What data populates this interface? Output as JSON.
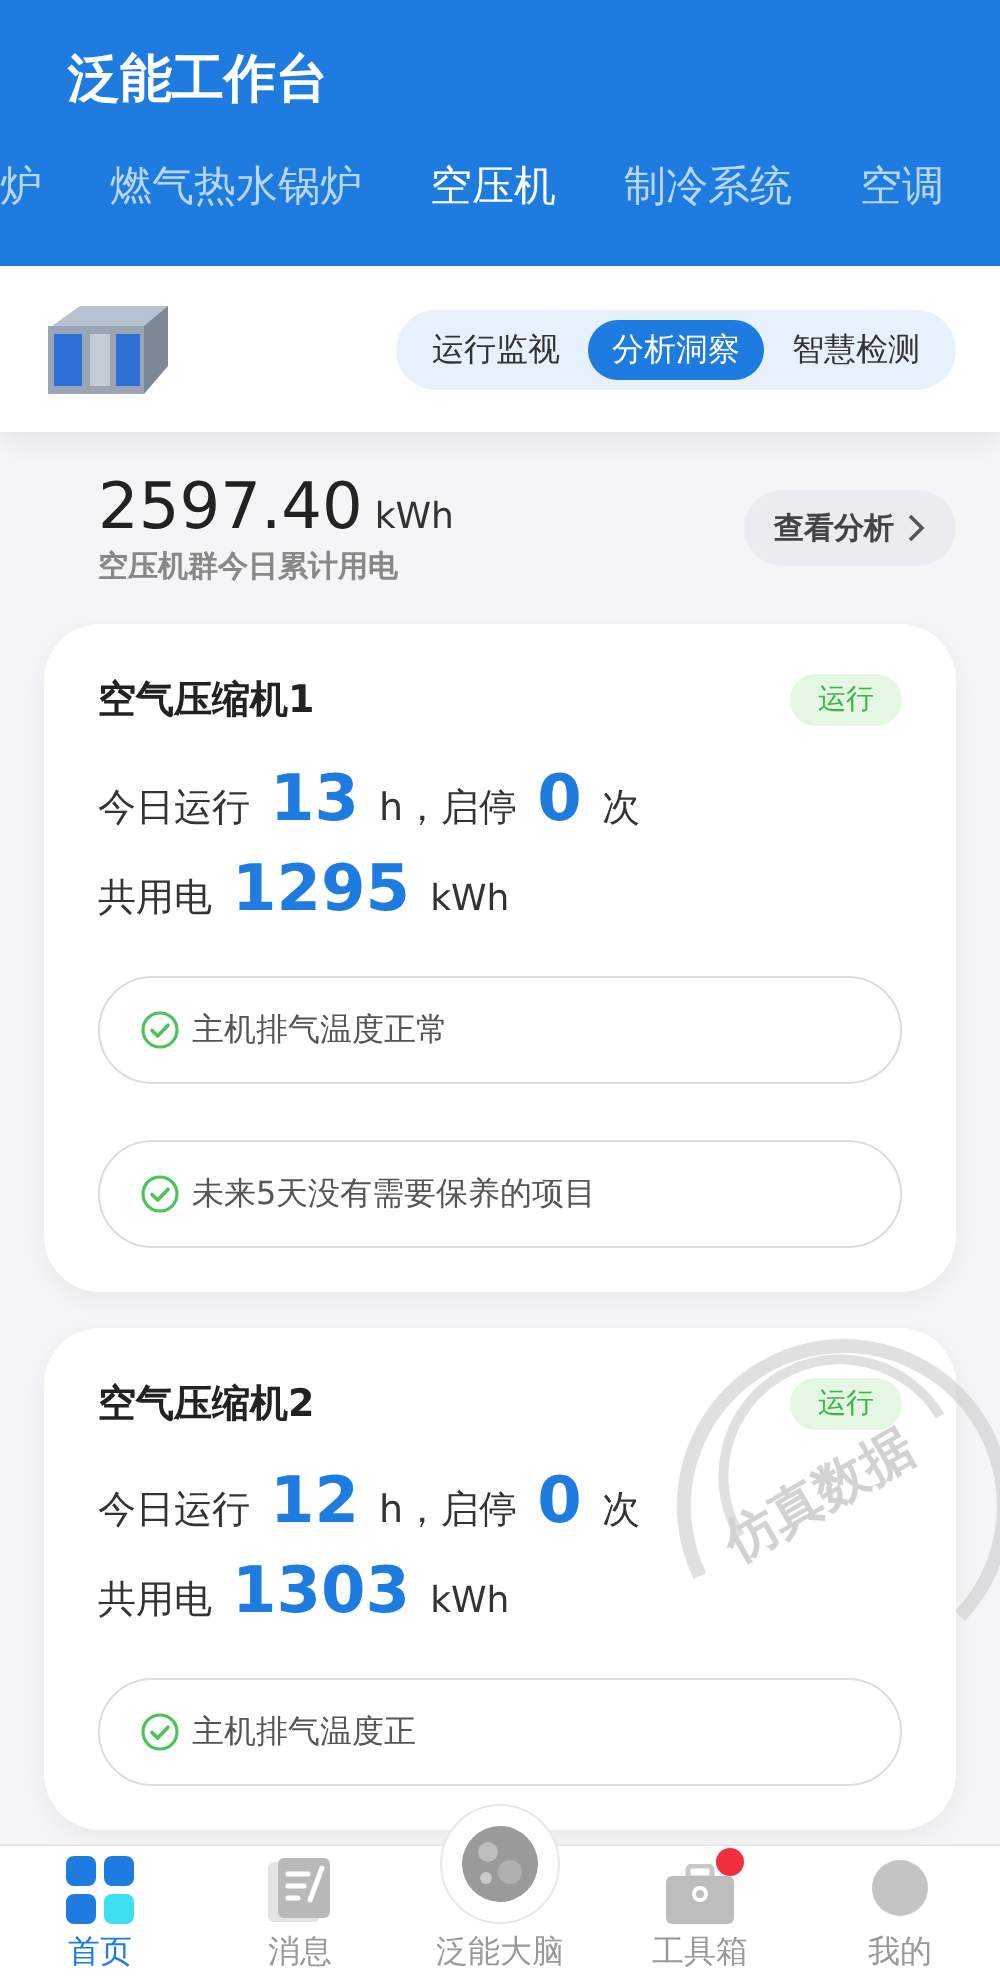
{
  "header": {
    "title": "泛能工作台"
  },
  "device_tabs": [
    {
      "label": "炉",
      "selected": false
    },
    {
      "label": "燃气热水锅炉",
      "selected": false
    },
    {
      "label": "空压机",
      "selected": true
    },
    {
      "label": "制冷系统",
      "selected": false
    },
    {
      "label": "空调",
      "selected": false
    }
  ],
  "view_tabs": [
    {
      "label": "运行监视",
      "selected": false
    },
    {
      "label": "分析洞察",
      "selected": true
    },
    {
      "label": "智慧检测",
      "selected": false
    }
  ],
  "summary": {
    "value": "2597.40",
    "unit": "kWh",
    "label": "空压机群今日累计用电",
    "button": "查看分析"
  },
  "machines": [
    {
      "name": "空气压缩机1",
      "status": "运行",
      "run_label": "今日运行",
      "run_hours": "13",
      "starts_label": "h，启停",
      "starts": "0",
      "starts_unit": "次",
      "energy_label": "共用电",
      "energy": "1295",
      "energy_unit": "kWh",
      "checks": [
        "主机排气温度正常",
        "未来5天没有需要保养的项目"
      ]
    },
    {
      "name": "空气压缩机2",
      "status": "运行",
      "run_label": "今日运行",
      "run_hours": "12",
      "starts_label": "h，启停",
      "starts": "0",
      "starts_unit": "次",
      "energy_label": "共用电",
      "energy": "1303",
      "energy_unit": "kWh",
      "checks": [
        "主机排气温度正"
      ]
    }
  ],
  "stamp": "仿真数据",
  "nav": [
    {
      "kind": "home",
      "label": "首页",
      "selected": true,
      "badge": false
    },
    {
      "kind": "message",
      "label": "消息",
      "selected": false,
      "badge": false
    },
    {
      "kind": "brain",
      "label": "泛能大脑",
      "selected": false,
      "badge": false
    },
    {
      "kind": "toolbox",
      "label": "工具箱",
      "selected": false,
      "badge": true
    },
    {
      "kind": "profile",
      "label": "我的",
      "selected": false,
      "badge": false
    }
  ]
}
